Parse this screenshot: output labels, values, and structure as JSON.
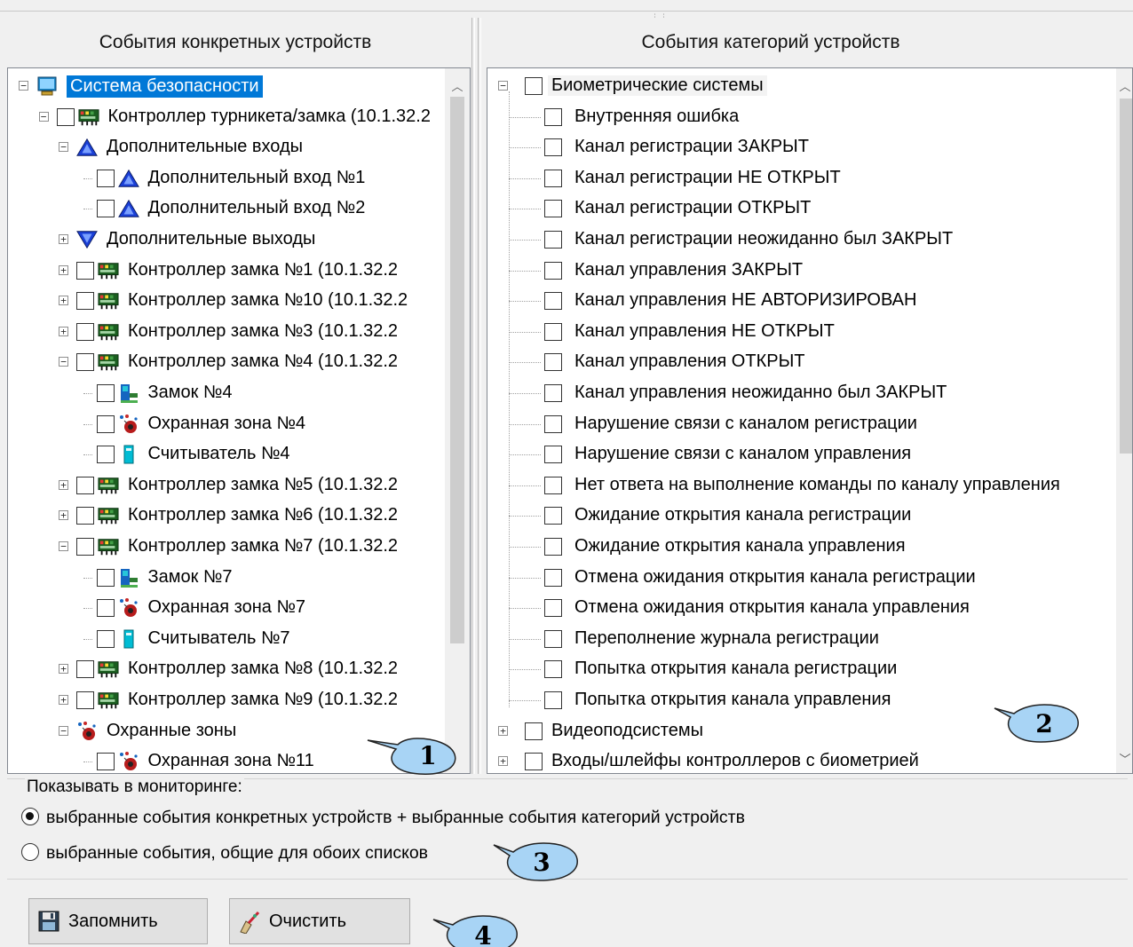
{
  "headers": {
    "left": "События конкретных устройств",
    "right": "События категорий устройств"
  },
  "left_tree": [
    {
      "label": "Система безопасности",
      "icon": "computer-icon",
      "exp": "minus",
      "checkbox": false,
      "selected": true
    },
    {
      "label": "Контроллер турникета/замка (10.1.32.2",
      "icon": "controller-icon",
      "exp": "minus",
      "checkbox": true
    },
    {
      "label": "Дополнительные входы",
      "icon": "input-triangle-icon",
      "exp": "minus",
      "checkbox": false
    },
    {
      "label": "Дополнительный вход №1",
      "icon": "input-triangle-icon",
      "exp": null,
      "checkbox": true
    },
    {
      "label": "Дополнительный вход №2",
      "icon": "input-triangle-icon",
      "exp": null,
      "checkbox": true
    },
    {
      "label": "Дополнительные выходы",
      "icon": "output-triangle-icon",
      "exp": "plus",
      "checkbox": false
    },
    {
      "label": "Контроллер замка №1 (10.1.32.2",
      "icon": "controller-icon",
      "exp": "plus",
      "checkbox": true
    },
    {
      "label": "Контроллер замка №10 (10.1.32.2",
      "icon": "controller-icon",
      "exp": "plus",
      "checkbox": true
    },
    {
      "label": "Контроллер замка №3 (10.1.32.2",
      "icon": "controller-icon",
      "exp": "plus",
      "checkbox": true
    },
    {
      "label": "Контроллер замка №4 (10.1.32.2",
      "icon": "controller-icon",
      "exp": "minus",
      "checkbox": true
    },
    {
      "label": "Замок №4",
      "icon": "lock-icon",
      "exp": null,
      "checkbox": true
    },
    {
      "label": "Охранная зона №4",
      "icon": "security-zone-icon",
      "exp": null,
      "checkbox": true
    },
    {
      "label": "Считыватель №4",
      "icon": "reader-icon",
      "exp": null,
      "checkbox": true
    },
    {
      "label": "Контроллер замка №5 (10.1.32.2",
      "icon": "controller-icon",
      "exp": "plus",
      "checkbox": true
    },
    {
      "label": "Контроллер замка №6 (10.1.32.2",
      "icon": "controller-icon",
      "exp": "plus",
      "checkbox": true
    },
    {
      "label": "Контроллер замка №7 (10.1.32.2",
      "icon": "controller-icon",
      "exp": "minus",
      "checkbox": true
    },
    {
      "label": "Замок №7",
      "icon": "lock-icon",
      "exp": null,
      "checkbox": true
    },
    {
      "label": "Охранная зона №7",
      "icon": "security-zone-icon",
      "exp": null,
      "checkbox": true
    },
    {
      "label": "Считыватель №7",
      "icon": "reader-icon",
      "exp": null,
      "checkbox": true
    },
    {
      "label": "Контроллер замка №8 (10.1.32.2",
      "icon": "controller-icon",
      "exp": "plus",
      "checkbox": true
    },
    {
      "label": "Контроллер замка №9 (10.1.32.2",
      "icon": "controller-icon",
      "exp": "plus",
      "checkbox": true
    },
    {
      "label": "Охранные зоны",
      "icon": "security-zone-icon",
      "exp": "minus",
      "checkbox": false
    },
    {
      "label": "Охранная зона №11",
      "icon": "security-zone-icon",
      "exp": null,
      "checkbox": true
    }
  ],
  "right_tree": {
    "root": "Биометрические системы",
    "items": [
      "Внутренняя ошибка",
      "Канал регистрации ЗАКРЫТ",
      "Канал регистрации НЕ ОТКРЫТ",
      "Канал регистрации ОТКРЫТ",
      "Канал регистрации неожиданно был ЗАКРЫТ",
      "Канал управления ЗАКРЫТ",
      "Канал управления НЕ АВТОРИЗИРОВАН",
      "Канал управления НЕ ОТКРЫТ",
      "Канал управления ОТКРЫТ",
      "Канал управления неожиданно был ЗАКРЫТ",
      "Нарушение связи с каналом регистрации",
      "Нарушение связи с каналом управления",
      "Нет ответа на выполнение команды по каналу управления",
      "Ожидание открытия канала регистрации",
      "Ожидание открытия канала управления",
      "Отмена ожидания открытия канала регистрации",
      "Отмена ожидания открытия канала управления",
      "Переполнение журнала регистрации",
      "Попытка открытия канала регистрации",
      "Попытка открытия канала управления"
    ],
    "collapsed_roots": [
      "Видеоподсистемы",
      "Входы/шлейфы контроллеров с биометрией"
    ]
  },
  "monitoring": {
    "label": "Показывать в мониторинге:",
    "option1": "выбранные события конкретных устройств + выбранные события категорий устройств",
    "option2": "выбранные события, общие для обоих списков",
    "selected": 1
  },
  "buttons": {
    "save": "Запомнить",
    "clear": "Очистить"
  },
  "callouts": [
    "1",
    "2",
    "3",
    "4"
  ]
}
